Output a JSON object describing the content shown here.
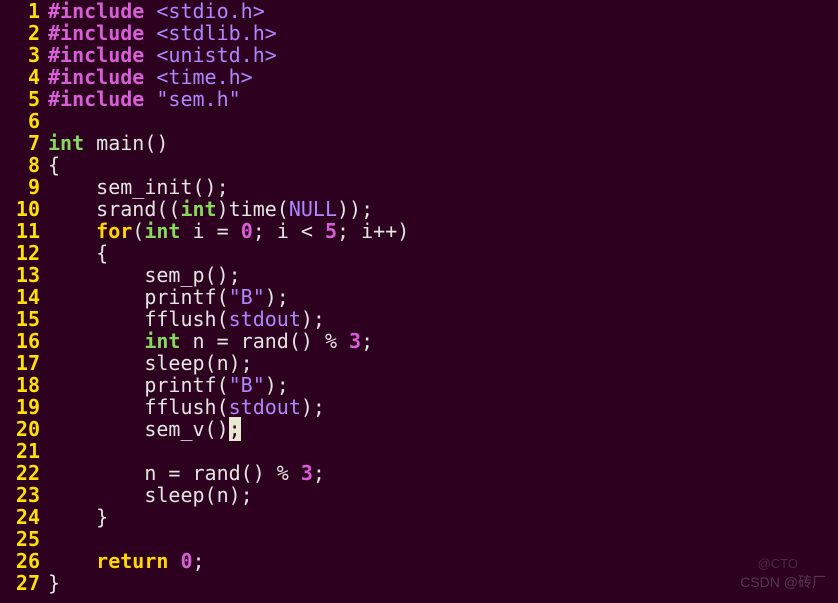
{
  "watermark_top": "@CTO",
  "watermark": "CSDN @砖厂",
  "cursor": {
    "line": 20,
    "col_after": "sem_v()",
    "char": ";"
  },
  "lines": [
    {
      "n": 1,
      "tokens": [
        {
          "t": "#include ",
          "c": "tk-pre"
        },
        {
          "t": "<stdio.h>",
          "c": "tk-hdr"
        }
      ]
    },
    {
      "n": 2,
      "tokens": [
        {
          "t": "#include ",
          "c": "tk-pre"
        },
        {
          "t": "<stdlib.h>",
          "c": "tk-hdr"
        }
      ]
    },
    {
      "n": 3,
      "tokens": [
        {
          "t": "#include ",
          "c": "tk-pre"
        },
        {
          "t": "<unistd.h>",
          "c": "tk-hdr"
        }
      ]
    },
    {
      "n": 4,
      "tokens": [
        {
          "t": "#include ",
          "c": "tk-pre"
        },
        {
          "t": "<time.h>",
          "c": "tk-hdr"
        }
      ]
    },
    {
      "n": 5,
      "tokens": [
        {
          "t": "#include ",
          "c": "tk-pre"
        },
        {
          "t": "\"sem.h\"",
          "c": "tk-hdr"
        }
      ]
    },
    {
      "n": 6,
      "tokens": [
        {
          "t": "",
          "c": "tk-plain"
        }
      ]
    },
    {
      "n": 7,
      "tokens": [
        {
          "t": "int",
          "c": "tk-type"
        },
        {
          "t": " main()",
          "c": "tk-plain"
        }
      ]
    },
    {
      "n": 8,
      "tokens": [
        {
          "t": "{",
          "c": "tk-plain"
        }
      ]
    },
    {
      "n": 9,
      "tokens": [
        {
          "t": "    sem_init();",
          "c": "tk-plain"
        }
      ]
    },
    {
      "n": 10,
      "tokens": [
        {
          "t": "    srand((",
          "c": "tk-plain"
        },
        {
          "t": "int",
          "c": "tk-type"
        },
        {
          "t": ")time(",
          "c": "tk-plain"
        },
        {
          "t": "NULL",
          "c": "tk-hdr"
        },
        {
          "t": "));",
          "c": "tk-plain"
        }
      ]
    },
    {
      "n": 11,
      "tokens": [
        {
          "t": "    ",
          "c": "tk-plain"
        },
        {
          "t": "for",
          "c": "tk-kw"
        },
        {
          "t": "(",
          "c": "tk-plain"
        },
        {
          "t": "int",
          "c": "tk-type"
        },
        {
          "t": " i = ",
          "c": "tk-plain"
        },
        {
          "t": "0",
          "c": "tk-num"
        },
        {
          "t": "; i < ",
          "c": "tk-plain"
        },
        {
          "t": "5",
          "c": "tk-num"
        },
        {
          "t": "; i++)",
          "c": "tk-plain"
        }
      ]
    },
    {
      "n": 12,
      "tokens": [
        {
          "t": "    {",
          "c": "tk-plain"
        }
      ]
    },
    {
      "n": 13,
      "tokens": [
        {
          "t": "        sem_p();",
          "c": "tk-plain"
        }
      ]
    },
    {
      "n": 14,
      "tokens": [
        {
          "t": "        printf(",
          "c": "tk-plain"
        },
        {
          "t": "\"B\"",
          "c": "tk-hdr"
        },
        {
          "t": ");",
          "c": "tk-plain"
        }
      ]
    },
    {
      "n": 15,
      "tokens": [
        {
          "t": "        fflush(",
          "c": "tk-plain"
        },
        {
          "t": "stdout",
          "c": "tk-hdr"
        },
        {
          "t": ");",
          "c": "tk-plain"
        }
      ]
    },
    {
      "n": 16,
      "tokens": [
        {
          "t": "        ",
          "c": "tk-plain"
        },
        {
          "t": "int",
          "c": "tk-type"
        },
        {
          "t": " n = rand() % ",
          "c": "tk-plain"
        },
        {
          "t": "3",
          "c": "tk-num"
        },
        {
          "t": ";",
          "c": "tk-plain"
        }
      ]
    },
    {
      "n": 17,
      "tokens": [
        {
          "t": "        sleep(n);",
          "c": "tk-plain"
        }
      ]
    },
    {
      "n": 18,
      "tokens": [
        {
          "t": "        printf(",
          "c": "tk-plain"
        },
        {
          "t": "\"B\"",
          "c": "tk-hdr"
        },
        {
          "t": ");",
          "c": "tk-plain"
        }
      ]
    },
    {
      "n": 19,
      "tokens": [
        {
          "t": "        fflush(",
          "c": "tk-plain"
        },
        {
          "t": "stdout",
          "c": "tk-hdr"
        },
        {
          "t": ");",
          "c": "tk-plain"
        }
      ]
    },
    {
      "n": 20,
      "tokens": [
        {
          "t": "        sem_v()",
          "c": "tk-plain"
        },
        {
          "t": ";",
          "c": "cursor"
        }
      ]
    },
    {
      "n": 21,
      "tokens": [
        {
          "t": "",
          "c": "tk-plain"
        }
      ]
    },
    {
      "n": 22,
      "tokens": [
        {
          "t": "        n = rand() % ",
          "c": "tk-plain"
        },
        {
          "t": "3",
          "c": "tk-num"
        },
        {
          "t": ";",
          "c": "tk-plain"
        }
      ]
    },
    {
      "n": 23,
      "tokens": [
        {
          "t": "        sleep(n);",
          "c": "tk-plain"
        }
      ]
    },
    {
      "n": 24,
      "tokens": [
        {
          "t": "    }",
          "c": "tk-plain"
        }
      ]
    },
    {
      "n": 25,
      "tokens": [
        {
          "t": "",
          "c": "tk-plain"
        }
      ]
    },
    {
      "n": 26,
      "tokens": [
        {
          "t": "    ",
          "c": "tk-plain"
        },
        {
          "t": "return",
          "c": "tk-kw"
        },
        {
          "t": " ",
          "c": "tk-plain"
        },
        {
          "t": "0",
          "c": "tk-num"
        },
        {
          "t": ";",
          "c": "tk-plain"
        }
      ]
    },
    {
      "n": 27,
      "tokens": [
        {
          "t": "}",
          "c": "tk-plain"
        }
      ]
    }
  ]
}
